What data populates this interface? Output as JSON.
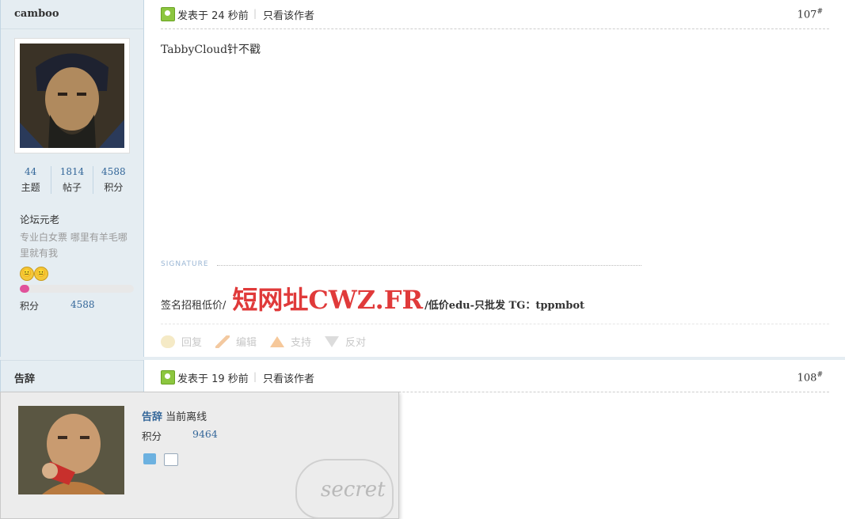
{
  "post1": {
    "author": "camboo",
    "stats": [
      {
        "value": "44",
        "label": "主题"
      },
      {
        "value": "1814",
        "label": "帖子"
      },
      {
        "value": "4588",
        "label": "积分"
      }
    ],
    "rank": "论坛元老",
    "motto": "专业白女票 哪里有羊毛哪里就有我",
    "emoji": [
      "😐",
      "😐"
    ],
    "level_progress": 0.08,
    "score_label": "积分",
    "score_value": "4588",
    "post_time": "发表于 24 秒前",
    "only_author": "只看该作者",
    "floor": "107",
    "floor_sup": "#",
    "content": "TabbyCloud针不戳",
    "signature_label": "SIGNATURE",
    "signature": {
      "prefix": "签名招租低价/",
      "big": "短网址CWZ.FR",
      "suffix": "/低价edu-只批发 TG：tppmbot"
    },
    "actions": [
      "回复",
      "编辑",
      "支持",
      "反对"
    ]
  },
  "post2": {
    "author": "告辞",
    "post_time": "发表于 19 秒前",
    "only_author": "只看该作者",
    "floor": "108",
    "floor_sup": "#"
  },
  "popup": {
    "username": "告辞",
    "status": "当前离线",
    "score_label": "积分",
    "score_value": "9464",
    "watermark": "secret"
  }
}
